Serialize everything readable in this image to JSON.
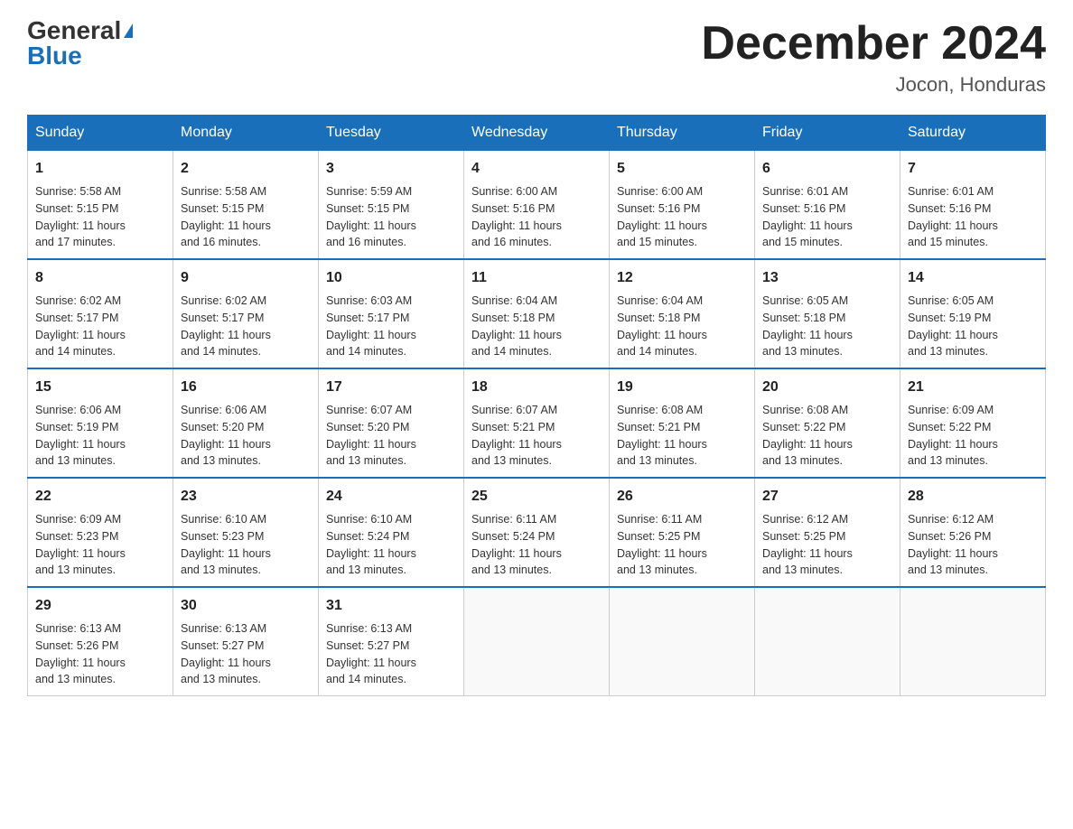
{
  "logo": {
    "general": "General",
    "blue": "Blue"
  },
  "title": "December 2024",
  "location": "Jocon, Honduras",
  "days_of_week": [
    "Sunday",
    "Monday",
    "Tuesday",
    "Wednesday",
    "Thursday",
    "Friday",
    "Saturday"
  ],
  "weeks": [
    [
      {
        "num": "1",
        "sunrise": "5:58 AM",
        "sunset": "5:15 PM",
        "daylight": "11 hours and 17 minutes."
      },
      {
        "num": "2",
        "sunrise": "5:58 AM",
        "sunset": "5:15 PM",
        "daylight": "11 hours and 16 minutes."
      },
      {
        "num": "3",
        "sunrise": "5:59 AM",
        "sunset": "5:15 PM",
        "daylight": "11 hours and 16 minutes."
      },
      {
        "num": "4",
        "sunrise": "6:00 AM",
        "sunset": "5:16 PM",
        "daylight": "11 hours and 16 minutes."
      },
      {
        "num": "5",
        "sunrise": "6:00 AM",
        "sunset": "5:16 PM",
        "daylight": "11 hours and 15 minutes."
      },
      {
        "num": "6",
        "sunrise": "6:01 AM",
        "sunset": "5:16 PM",
        "daylight": "11 hours and 15 minutes."
      },
      {
        "num": "7",
        "sunrise": "6:01 AM",
        "sunset": "5:16 PM",
        "daylight": "11 hours and 15 minutes."
      }
    ],
    [
      {
        "num": "8",
        "sunrise": "6:02 AM",
        "sunset": "5:17 PM",
        "daylight": "11 hours and 14 minutes."
      },
      {
        "num": "9",
        "sunrise": "6:02 AM",
        "sunset": "5:17 PM",
        "daylight": "11 hours and 14 minutes."
      },
      {
        "num": "10",
        "sunrise": "6:03 AM",
        "sunset": "5:17 PM",
        "daylight": "11 hours and 14 minutes."
      },
      {
        "num": "11",
        "sunrise": "6:04 AM",
        "sunset": "5:18 PM",
        "daylight": "11 hours and 14 minutes."
      },
      {
        "num": "12",
        "sunrise": "6:04 AM",
        "sunset": "5:18 PM",
        "daylight": "11 hours and 14 minutes."
      },
      {
        "num": "13",
        "sunrise": "6:05 AM",
        "sunset": "5:18 PM",
        "daylight": "11 hours and 13 minutes."
      },
      {
        "num": "14",
        "sunrise": "6:05 AM",
        "sunset": "5:19 PM",
        "daylight": "11 hours and 13 minutes."
      }
    ],
    [
      {
        "num": "15",
        "sunrise": "6:06 AM",
        "sunset": "5:19 PM",
        "daylight": "11 hours and 13 minutes."
      },
      {
        "num": "16",
        "sunrise": "6:06 AM",
        "sunset": "5:20 PM",
        "daylight": "11 hours and 13 minutes."
      },
      {
        "num": "17",
        "sunrise": "6:07 AM",
        "sunset": "5:20 PM",
        "daylight": "11 hours and 13 minutes."
      },
      {
        "num": "18",
        "sunrise": "6:07 AM",
        "sunset": "5:21 PM",
        "daylight": "11 hours and 13 minutes."
      },
      {
        "num": "19",
        "sunrise": "6:08 AM",
        "sunset": "5:21 PM",
        "daylight": "11 hours and 13 minutes."
      },
      {
        "num": "20",
        "sunrise": "6:08 AM",
        "sunset": "5:22 PM",
        "daylight": "11 hours and 13 minutes."
      },
      {
        "num": "21",
        "sunrise": "6:09 AM",
        "sunset": "5:22 PM",
        "daylight": "11 hours and 13 minutes."
      }
    ],
    [
      {
        "num": "22",
        "sunrise": "6:09 AM",
        "sunset": "5:23 PM",
        "daylight": "11 hours and 13 minutes."
      },
      {
        "num": "23",
        "sunrise": "6:10 AM",
        "sunset": "5:23 PM",
        "daylight": "11 hours and 13 minutes."
      },
      {
        "num": "24",
        "sunrise": "6:10 AM",
        "sunset": "5:24 PM",
        "daylight": "11 hours and 13 minutes."
      },
      {
        "num": "25",
        "sunrise": "6:11 AM",
        "sunset": "5:24 PM",
        "daylight": "11 hours and 13 minutes."
      },
      {
        "num": "26",
        "sunrise": "6:11 AM",
        "sunset": "5:25 PM",
        "daylight": "11 hours and 13 minutes."
      },
      {
        "num": "27",
        "sunrise": "6:12 AM",
        "sunset": "5:25 PM",
        "daylight": "11 hours and 13 minutes."
      },
      {
        "num": "28",
        "sunrise": "6:12 AM",
        "sunset": "5:26 PM",
        "daylight": "11 hours and 13 minutes."
      }
    ],
    [
      {
        "num": "29",
        "sunrise": "6:13 AM",
        "sunset": "5:26 PM",
        "daylight": "11 hours and 13 minutes."
      },
      {
        "num": "30",
        "sunrise": "6:13 AM",
        "sunset": "5:27 PM",
        "daylight": "11 hours and 13 minutes."
      },
      {
        "num": "31",
        "sunrise": "6:13 AM",
        "sunset": "5:27 PM",
        "daylight": "11 hours and 14 minutes."
      },
      null,
      null,
      null,
      null
    ]
  ]
}
